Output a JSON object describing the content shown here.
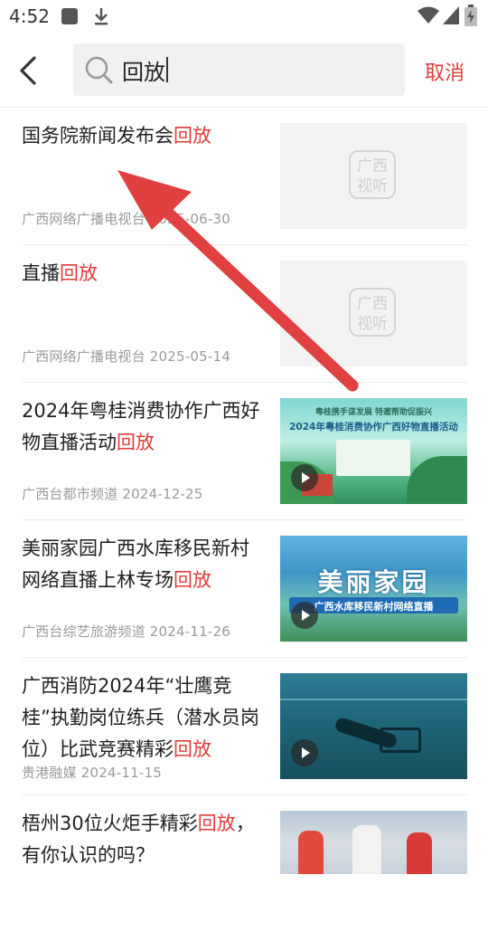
{
  "status_bar": {
    "time": "4:52"
  },
  "header": {
    "search_value": "回放",
    "cancel_label": "取消"
  },
  "news": [
    {
      "title_pre": "国务院新闻发布会",
      "title_hl": "回放",
      "title_post": "",
      "meta": "广西网络广播电视台 2025-06-30",
      "thumb": "placeholder",
      "thumb_logo": "广西视听"
    },
    {
      "title_pre": "直播",
      "title_hl": "回放",
      "title_post": "",
      "meta": "广西网络广播电视台 2025-05-14",
      "thumb": "placeholder",
      "thumb_logo": "广西视听"
    },
    {
      "title_pre": "2024年粤桂消费协作广西好物直播活动",
      "title_hl": "回放",
      "title_post": "",
      "meta": "广西台都市频道 2024-12-25",
      "thumb": "event",
      "thumb_top": "粤桂携手谋发展 特邀帮助促振兴",
      "thumb_caption": "2024年粤桂消费协作广西好物直播活动"
    },
    {
      "title_pre": "美丽家园广西水库移民新村网络直播上林专场",
      "title_hl": "回放",
      "title_post": "",
      "meta": "广西台综艺旅游频道 2024-11-26",
      "thumb": "lake",
      "thumb_big": "美丽家园",
      "thumb_caption": "广西水库移民新村网络直播"
    },
    {
      "title_pre": "广西消防2024年“壮鹰竞桂”执勤岗位练兵（潜水员岗位）比武竞赛精彩",
      "title_hl": "回放",
      "title_post": "",
      "meta": "贵港融媒 2024-11-15",
      "thumb": "underwater"
    },
    {
      "title_pre": "梧州30位火炬手精彩",
      "title_hl": "回放",
      "title_post": "，有你认识的吗？",
      "meta": "",
      "thumb": "torch"
    }
  ],
  "colors": {
    "highlight": "#e33b3b",
    "meta": "#9a9a9a",
    "arrow": "#e0403f"
  }
}
